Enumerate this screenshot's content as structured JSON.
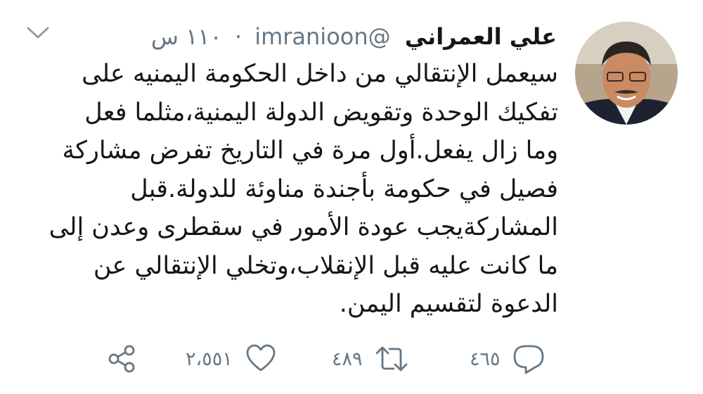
{
  "tweet": {
    "author_name": "علي العمراني",
    "handle": "@imranioon",
    "dot": "·",
    "time": "١١٠ س",
    "lines": [
      "سيعمل الإنتقالي من داخل الحكومة اليمنيه على",
      "تفكيك الوحدة وتقويض الدولة اليمنية،مثلما فعل",
      "وما زال يفعل.أول مرة في التاريخ تفرض مشاركة",
      "فصيل في حكومة بأجندة مناوئة للدولة.قبل",
      "المشاركةيجب عودة الأمور في سقطرى وعدن إلى",
      "ما كانت عليه قبل الإنقلاب،وتخلي الإنتقالي عن",
      "الدعوة لتقسيم اليمن."
    ]
  },
  "actions": {
    "reply_count": "٤٦٥",
    "retweet_count": "٤٨٩",
    "like_count": "٢،٥٥١"
  },
  "icons": {
    "menu": "chevron-down-icon",
    "reply": "reply-icon",
    "retweet": "retweet-icon",
    "like": "heart-icon",
    "share": "share-icon"
  },
  "colors": {
    "text": "#14171a",
    "secondary": "#657786"
  }
}
